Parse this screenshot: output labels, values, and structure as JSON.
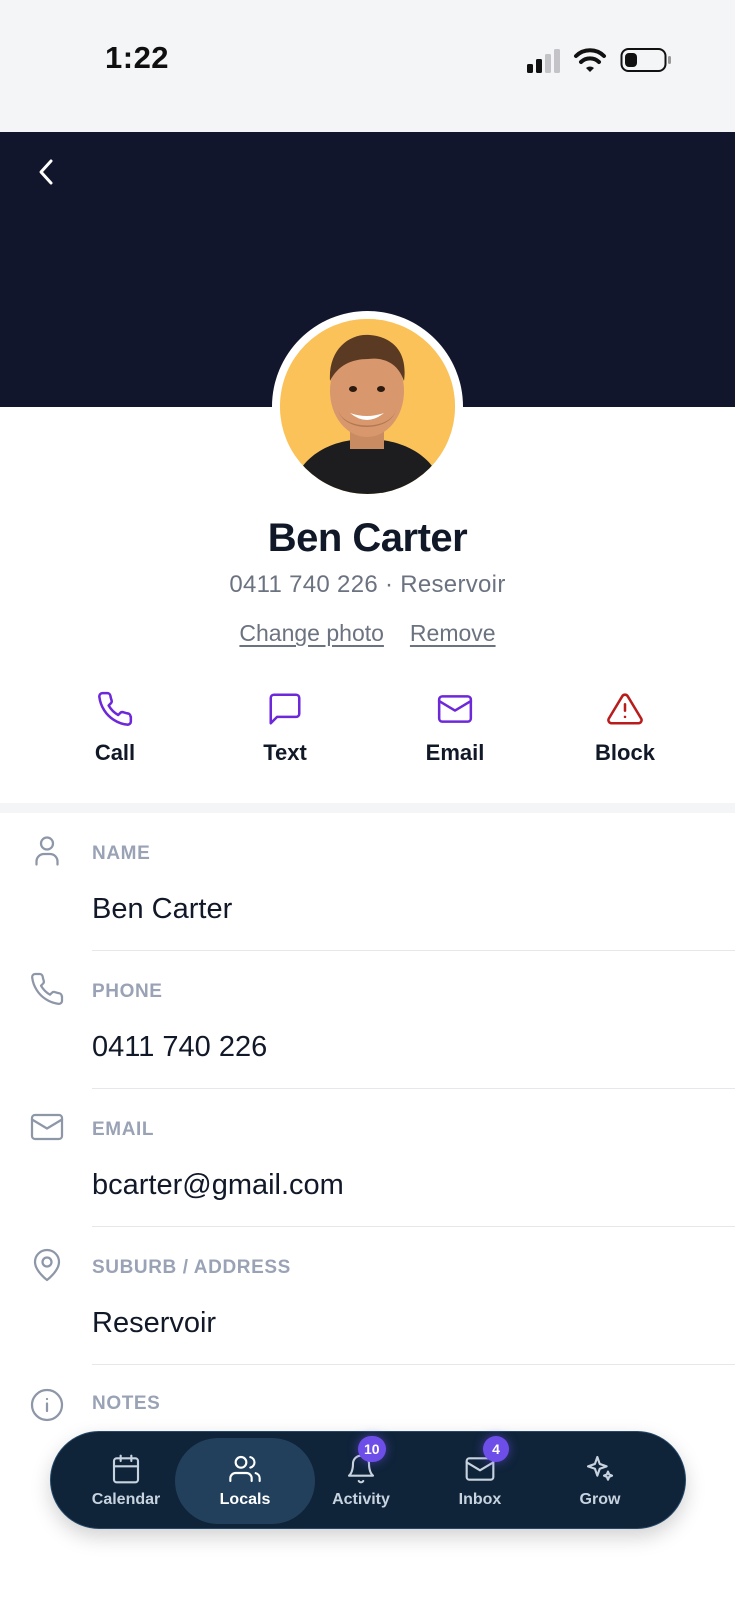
{
  "status_bar": {
    "time": "1:22"
  },
  "profile": {
    "name": "Ben Carter",
    "subline": "0411 740 226 · Reservoir",
    "change_photo": "Change photo",
    "remove": "Remove"
  },
  "actions": [
    {
      "label": "Call",
      "icon": "phone-icon"
    },
    {
      "label": "Text",
      "icon": "message-icon"
    },
    {
      "label": "Email",
      "icon": "mail-icon"
    },
    {
      "label": "Block",
      "icon": "warning-icon"
    }
  ],
  "fields": [
    {
      "label": "NAME",
      "value": "Ben Carter",
      "icon": "person-icon"
    },
    {
      "label": "PHONE",
      "value": "0411 740 226",
      "icon": "phone-icon"
    },
    {
      "label": "EMAIL",
      "value": "bcarter@gmail.com",
      "icon": "mail-icon"
    },
    {
      "label": "SUBURB / ADDRESS",
      "value": "Reservoir",
      "icon": "location-pin-icon"
    },
    {
      "label": "NOTES",
      "value": "",
      "icon": "info-icon"
    }
  ],
  "tabbar": {
    "tabs": [
      {
        "label": "Calendar",
        "icon": "calendar-icon"
      },
      {
        "label": "Locals",
        "icon": "people-icon",
        "active": true
      },
      {
        "label": "Activity",
        "icon": "bell-icon",
        "badge": "10"
      },
      {
        "label": "Inbox",
        "icon": "inbox-icon",
        "badge": "4"
      },
      {
        "label": "Grow",
        "icon": "sparkle-icon"
      }
    ]
  },
  "colors": {
    "hero": "#12162c",
    "accent": "#6d28d9",
    "danger": "#b91c1c",
    "tabbar": "#0f2439",
    "badge": "#6d4ee8"
  }
}
